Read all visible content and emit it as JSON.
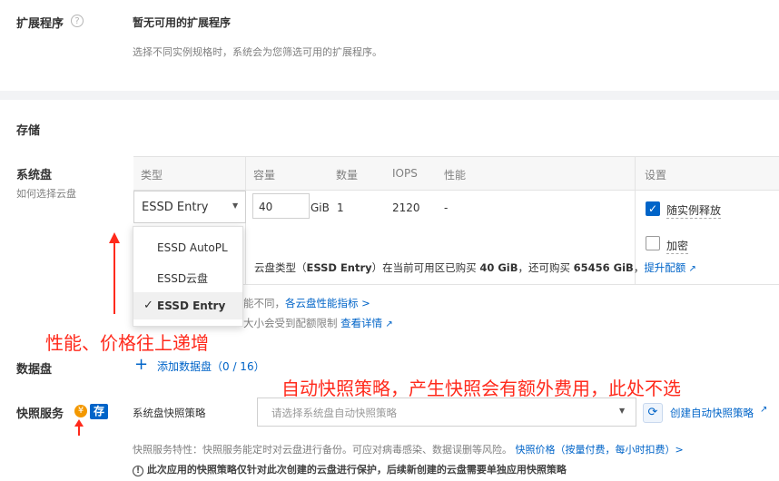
{
  "extension": {
    "label": "扩展程序",
    "help_icon": "?",
    "status": "暂无可用的扩展程序",
    "note": "选择不同实例规格时，系统会为您筛选可用的扩展程序。"
  },
  "storage": {
    "section_title": "存储",
    "system_disk": {
      "label": "系统盘",
      "help_link": "如何选择云盘",
      "columns": [
        "类型",
        "容量",
        "数量",
        "IOPS",
        "性能",
        "设置"
      ],
      "selected_type": "ESSD Entry",
      "capacity_value": "40",
      "capacity_unit": "GiB",
      "count": "1",
      "iops": "2120",
      "performance": "-",
      "release_with_instance": "随实例释放",
      "release_checked": true,
      "encrypt": "加密",
      "encrypt_checked": false,
      "quota_text_1": "云盘类型（",
      "quota_type": "ESSD Entry",
      "quota_text_2": "）在当前可用区已购买 ",
      "quota_bought": "40 GiB",
      "quota_text_3": "，还可购买 ",
      "quota_remain": "65456 GiB",
      "quota_text_4": "，",
      "quota_link": "提升配额",
      "perf_note_partial": "能不同，",
      "perf_link": "各云盘性能指标 >",
      "limit_note_partial": "大小会受到配额限制",
      "limit_link": "查看详情",
      "dropdown_options": [
        "ESSD AutoPL",
        "ESSD云盘",
        "ESSD Entry"
      ],
      "dropdown_selected_mark": "✓"
    },
    "data_disk": {
      "label": "数据盘",
      "add_label": "添加数据盘（0 / 16）"
    }
  },
  "snapshot": {
    "label": "快照服务",
    "yen_badge": "¥",
    "cun_badge": "存",
    "policy_label": "系统盘快照策略",
    "policy_placeholder": "请选择系统盘自动快照策略",
    "create_link": "创建自动快照策略",
    "feature_text": "快照服务特性：快照服务能定时对云盘进行备份。可应对病毒感染、数据误删等风险。",
    "price_link": "快照价格（按量付费，每小时扣费）>",
    "warning": "此次应用的快照策略仅针对此次创建的云盘进行保护，后续新创建的云盘需要单独应用快照策略"
  },
  "annotations": {
    "perf_price_note": "性能、价格往上递增",
    "snapshot_note": "自动快照策略，产生快照会有额外费用，此处不选"
  },
  "colors": {
    "accent": "#0064c8",
    "annotation_red": "#ff2a1c",
    "badge_orange": "#f39800"
  }
}
